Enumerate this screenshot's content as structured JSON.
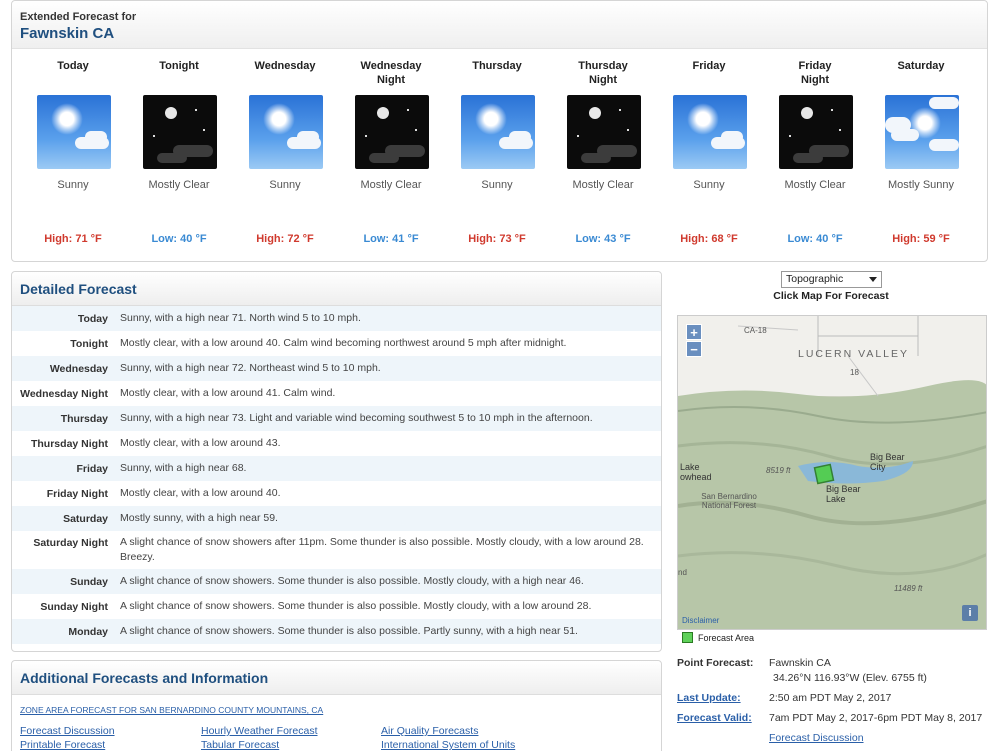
{
  "extended": {
    "subtitle": "Extended Forecast for",
    "city": "Fawnskin CA",
    "periods": [
      {
        "name": "Today",
        "desc": "Sunny",
        "temp": "High: 71 °F",
        "kind": "high",
        "icon": "sunny-icon"
      },
      {
        "name": "Tonight",
        "desc": "Mostly Clear",
        "temp": "Low: 40 °F",
        "kind": "low",
        "icon": "mostly-clear-night-icon"
      },
      {
        "name": "Wednesday",
        "desc": "Sunny",
        "temp": "High: 72 °F",
        "kind": "high",
        "icon": "sunny-icon"
      },
      {
        "name": "Wednesday Night",
        "desc": "Mostly Clear",
        "temp": "Low: 41 °F",
        "kind": "low",
        "icon": "mostly-clear-night-icon"
      },
      {
        "name": "Thursday",
        "desc": "Sunny",
        "temp": "High: 73 °F",
        "kind": "high",
        "icon": "sunny-icon"
      },
      {
        "name": "Thursday Night",
        "desc": "Mostly Clear",
        "temp": "Low: 43 °F",
        "kind": "low",
        "icon": "mostly-clear-night-icon"
      },
      {
        "name": "Friday",
        "desc": "Sunny",
        "temp": "High: 68 °F",
        "kind": "high",
        "icon": "sunny-icon"
      },
      {
        "name": "Friday Night",
        "desc": "Mostly Clear",
        "temp": "Low: 40 °F",
        "kind": "low",
        "icon": "mostly-clear-night-icon"
      },
      {
        "name": "Saturday",
        "desc": "Mostly Sunny",
        "temp": "High: 59 °F",
        "kind": "high",
        "icon": "mostly-sunny-icon"
      }
    ]
  },
  "detailed": {
    "title": "Detailed Forecast",
    "rows": [
      {
        "label": "Today",
        "text": "Sunny, with a high near 71. North wind 5 to 10 mph."
      },
      {
        "label": "Tonight",
        "text": "Mostly clear, with a low around 40. Calm wind becoming northwest around 5 mph after midnight."
      },
      {
        "label": "Wednesday",
        "text": "Sunny, with a high near 72. Northeast wind 5 to 10 mph."
      },
      {
        "label": "Wednesday Night",
        "text": "Mostly clear, with a low around 41. Calm wind."
      },
      {
        "label": "Thursday",
        "text": "Sunny, with a high near 73. Light and variable wind becoming southwest 5 to 10 mph in the afternoon."
      },
      {
        "label": "Thursday Night",
        "text": "Mostly clear, with a low around 43."
      },
      {
        "label": "Friday",
        "text": "Sunny, with a high near 68."
      },
      {
        "label": "Friday Night",
        "text": "Mostly clear, with a low around 40."
      },
      {
        "label": "Saturday",
        "text": "Mostly sunny, with a high near 59."
      },
      {
        "label": "Saturday Night",
        "text": "A slight chance of snow showers after 11pm. Some thunder is also possible. Mostly cloudy, with a low around 28. Breezy."
      },
      {
        "label": "Sunday",
        "text": "A slight chance of snow showers. Some thunder is also possible. Mostly cloudy, with a high near 46."
      },
      {
        "label": "Sunday Night",
        "text": "A slight chance of snow showers. Some thunder is also possible. Mostly cloudy, with a low around 28."
      },
      {
        "label": "Monday",
        "text": "A slight chance of snow showers. Some thunder is also possible. Partly sunny, with a high near 51."
      }
    ]
  },
  "additional": {
    "title": "Additional Forecasts and Information",
    "zone_link": "ZONE AREA FORECAST FOR SAN BERNARDINO COUNTY MOUNTAINS, CA",
    "links": {
      "discussion": "Forecast Discussion",
      "printable": "Printable Forecast",
      "hourly": "Hourly Weather Forecast",
      "tabular": "Tabular Forecast",
      "air": "Air Quality Forecasts",
      "units": "International System of Units"
    }
  },
  "map": {
    "select_value": "Topographic",
    "caption": "Click Map For Forecast",
    "zoom_in": "+",
    "zoom_out": "−",
    "info": "i",
    "labels": {
      "ca18": "CA-18",
      "lucern": "LUCERN VALLEY",
      "eighteen": "18",
      "big_bear_city": "Big Bear City",
      "big_bear_lake": "Big Bear Lake",
      "lake_arrowhead": "Lake owhead",
      "elev_8519": "8519 ft",
      "sbnf": "San Bernardino National Forest",
      "elev_11489": "11489 ft",
      "nd": "nd",
      "disclaimer": "Disclaimer"
    },
    "legend": "Forecast Area"
  },
  "point": {
    "label": "Point Forecast:",
    "city": "Fawnskin CA",
    "coords": "34.26°N 116.93°W (Elev. 6755 ft)",
    "last_update_label": "Last Update:",
    "last_update": "2:50 am PDT May 2, 2017",
    "valid_label": "Forecast Valid:",
    "valid": "7am PDT May 2, 2017-6pm PDT May 8, 2017",
    "discussion_link": "Forecast Discussion"
  }
}
